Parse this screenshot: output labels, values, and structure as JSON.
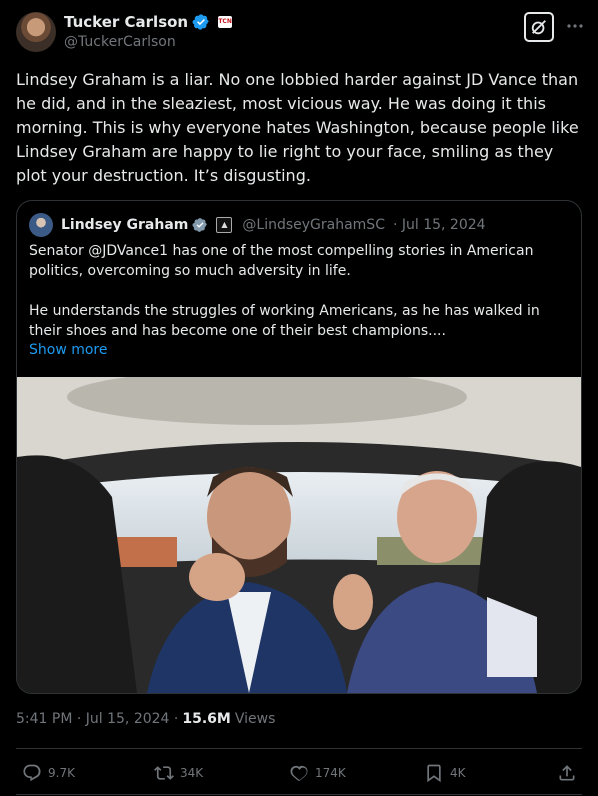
{
  "author": {
    "name": "Tucker Carlson",
    "handle": "@TuckerCarlson",
    "affiliation_badge": "TCN"
  },
  "tweet": {
    "text": "Lindsey Graham is a liar. No one lobbied harder against JD Vance than he did, and in the sleaziest, most vicious way. He was doing it this morning. This is why everyone hates Washington, because people like Lindsey Graham are happy to lie right to your face, smiling as they plot your destruction. It’s disgusting."
  },
  "quoted": {
    "name": "Lindsey Graham",
    "handle": "@LindseyGrahamSC",
    "date": "· Jul 15, 2024",
    "text": "Senator @JDVance1 has one of the most compelling stories in American politics, overcoming so much adversity in life.\n\nHe understands the struggles of working Americans, as he has walked in their shoes and has become one of their best champions....",
    "show_more": "Show more"
  },
  "meta": {
    "time_date": "5:41 PM · Jul 15, 2024 ·",
    "views_count": "15.6M",
    "views_label": "Views"
  },
  "actions": {
    "replies": "9.7K",
    "reposts": "34K",
    "likes": "174K",
    "bookmarks": "4K"
  },
  "colors": {
    "background": "#000000",
    "text": "#e7e9ea",
    "muted": "#71767b",
    "accent": "#1d9bf0",
    "border": "#2f3336"
  }
}
